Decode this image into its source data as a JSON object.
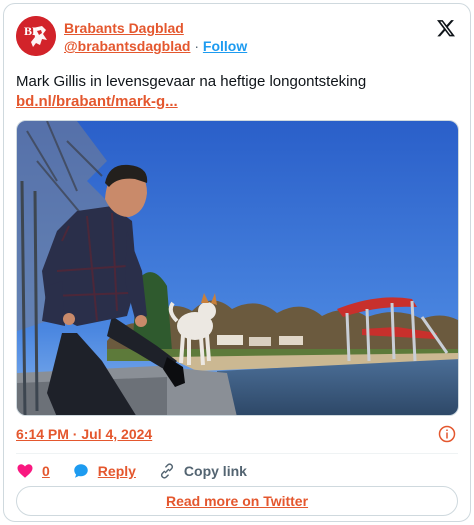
{
  "author": {
    "display_name": "Brabants Dagblad",
    "handle": "@brabantsdagblad",
    "separator": "·",
    "follow_label": "Follow",
    "avatar_text": "BD"
  },
  "tweet": {
    "text": "Mark Gillis in levensgevaar na heftige longontsteking",
    "link": "bd.nl/brabant/mark-g..."
  },
  "meta": {
    "timestamp": "6:14 PM · Jul 4, 2024"
  },
  "actions": {
    "like_count": "0",
    "reply_label": "Reply",
    "copy_label": "Copy link"
  },
  "read_more_label": "Read more on Twitter",
  "colors": {
    "link": "#e4572e",
    "brand": "#d2232a",
    "follow": "#1d9bf0",
    "like": "#f91880",
    "reply": "#1d9bf0"
  },
  "icons": [
    "x-logo-icon",
    "info-icon",
    "heart-icon",
    "reply-bubble-icon",
    "link-icon"
  ]
}
